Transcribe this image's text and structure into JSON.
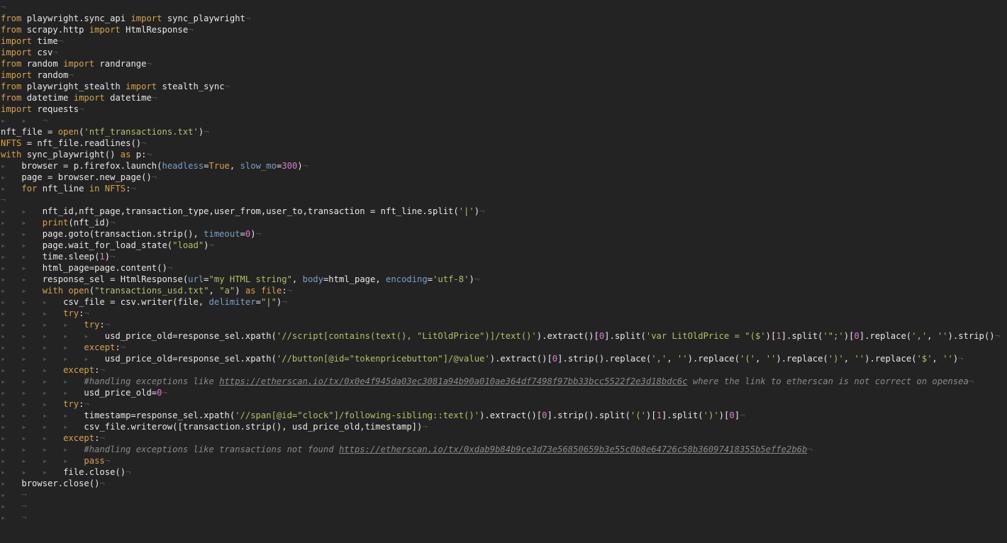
{
  "editor": {
    "theme": {
      "background": "#232323",
      "text": "#e8e8e8",
      "keyword": "#d9a24a",
      "string": "#b7bf6a",
      "number": "#d37fd0",
      "parameter": "#7a9fc7",
      "comment": "#8a8a8a",
      "invisible": "#4e4e4e"
    },
    "lines": [
      [],
      [
        [
          "kw",
          "from"
        ],
        [
          "t",
          " playwright.sync_api "
        ],
        [
          "kw",
          "import"
        ],
        [
          "t",
          " sync_playwright"
        ]
      ],
      [
        [
          "kw",
          "from"
        ],
        [
          "t",
          " scrapy.http "
        ],
        [
          "kw",
          "import"
        ],
        [
          "t",
          " HtmlResponse"
        ]
      ],
      [
        [
          "kw",
          "import"
        ],
        [
          "t",
          " time"
        ]
      ],
      [
        [
          "kw",
          "import"
        ],
        [
          "t",
          " csv"
        ]
      ],
      [
        [
          "kw",
          "from"
        ],
        [
          "t",
          " random "
        ],
        [
          "kw",
          "import"
        ],
        [
          "t",
          " randrange"
        ]
      ],
      [
        [
          "kw",
          "import"
        ],
        [
          "t",
          " random"
        ]
      ],
      [
        [
          "kw",
          "from"
        ],
        [
          "t",
          " playwright_stealth "
        ],
        [
          "kw",
          "import"
        ],
        [
          "t",
          " stealth_sync"
        ]
      ],
      [
        [
          "kw",
          "from"
        ],
        [
          "t",
          " datetime "
        ],
        [
          "kw",
          "import"
        ],
        [
          "t",
          " datetime"
        ]
      ],
      [
        [
          "kw",
          "import"
        ],
        [
          "t",
          " requests"
        ]
      ],
      [
        [
          "inv",
          "▸   ▸   "
        ]
      ],
      [
        [
          "t",
          "nft_file = "
        ],
        [
          "kw",
          "open"
        ],
        [
          "t",
          "("
        ],
        [
          "str",
          "'ntf_transactions.txt'"
        ],
        [
          "t",
          ")"
        ]
      ],
      [
        [
          "vr",
          "NFTS"
        ],
        [
          "t",
          " = nft_file.readlines()"
        ]
      ],
      [
        [
          "kw",
          "with"
        ],
        [
          "t",
          " sync_playwright() "
        ],
        [
          "kw",
          "as"
        ],
        [
          "t",
          " p:"
        ]
      ],
      [
        [
          "inv",
          "▸   "
        ],
        [
          "t",
          "browser = p.firefox.launch("
        ],
        [
          "par",
          "headless"
        ],
        [
          "t",
          "="
        ],
        [
          "kw",
          "True"
        ],
        [
          "t",
          ", "
        ],
        [
          "par",
          "slow_mo"
        ],
        [
          "t",
          "="
        ],
        [
          "num",
          "300"
        ],
        [
          "t",
          ")"
        ]
      ],
      [
        [
          "inv",
          "▸   "
        ],
        [
          "t",
          "page = browser.new_page()"
        ]
      ],
      [
        [
          "inv",
          "▸   "
        ],
        [
          "kw",
          "for"
        ],
        [
          "t",
          " nft_line "
        ],
        [
          "kw",
          "in"
        ],
        [
          "t",
          " "
        ],
        [
          "vr",
          "NFTS"
        ],
        [
          "t",
          ":"
        ]
      ],
      [],
      [
        [
          "inv",
          "▸   ▸   "
        ],
        [
          "t",
          "nft_id,nft_page,transaction_type,user_from,user_to,transaction = nft_line.split("
        ],
        [
          "str",
          "'|'"
        ],
        [
          "t",
          ")"
        ]
      ],
      [
        [
          "inv",
          "▸   ▸   "
        ],
        [
          "kw",
          "print"
        ],
        [
          "t",
          "(nft_id)"
        ]
      ],
      [
        [
          "inv",
          "▸   ▸   "
        ],
        [
          "t",
          "page.goto(transaction.strip(), "
        ],
        [
          "par",
          "timeout"
        ],
        [
          "t",
          "="
        ],
        [
          "num",
          "0"
        ],
        [
          "t",
          ")"
        ]
      ],
      [
        [
          "inv",
          "▸   ▸   "
        ],
        [
          "t",
          "page.wait_for_load_state("
        ],
        [
          "str",
          "\"load\""
        ],
        [
          "t",
          ")"
        ]
      ],
      [
        [
          "inv",
          "▸   ▸   "
        ],
        [
          "t",
          "time.sleep("
        ],
        [
          "num",
          "1"
        ],
        [
          "t",
          ")"
        ]
      ],
      [
        [
          "inv",
          "▸   ▸   "
        ],
        [
          "t",
          "html_page=page.content()"
        ]
      ],
      [
        [
          "inv",
          "▸   ▸   "
        ],
        [
          "t",
          "response_sel = HtmlResponse("
        ],
        [
          "par",
          "url"
        ],
        [
          "t",
          "="
        ],
        [
          "str",
          "\"my HTML string\""
        ],
        [
          "t",
          ", "
        ],
        [
          "par",
          "body"
        ],
        [
          "t",
          "=html_page, "
        ],
        [
          "par",
          "encoding"
        ],
        [
          "t",
          "="
        ],
        [
          "str",
          "'utf-8'"
        ],
        [
          "t",
          ")"
        ]
      ],
      [
        [
          "inv",
          "▸   ▸   "
        ],
        [
          "kw",
          "with"
        ],
        [
          "t",
          " "
        ],
        [
          "kw",
          "open"
        ],
        [
          "t",
          "("
        ],
        [
          "str",
          "\"transactions_usd.txt\""
        ],
        [
          "t",
          ", "
        ],
        [
          "str",
          "\"a\""
        ],
        [
          "t",
          ") "
        ],
        [
          "kw",
          "as"
        ],
        [
          "t",
          " "
        ],
        [
          "kw",
          "file"
        ],
        [
          "t",
          ":"
        ]
      ],
      [
        [
          "inv",
          "▸   ▸   ▸   "
        ],
        [
          "t",
          "csv_file = csv.writer(file, "
        ],
        [
          "par",
          "delimiter"
        ],
        [
          "t",
          "="
        ],
        [
          "str",
          "\"|\""
        ],
        [
          "t",
          ")"
        ]
      ],
      [
        [
          "inv",
          "▸   ▸   ▸   "
        ],
        [
          "kw",
          "try"
        ],
        [
          "t",
          ":"
        ]
      ],
      [
        [
          "inv",
          "▸   ▸   ▸   ▸   "
        ],
        [
          "kw",
          "try"
        ],
        [
          "t",
          ":"
        ]
      ],
      [
        [
          "inv",
          "▸   ▸   ▸   ▸   ▸   "
        ],
        [
          "t",
          "usd_price_old=response_sel.xpath("
        ],
        [
          "str",
          "'//script[contains(text(), \"LitOldPrice\")]/text()'"
        ],
        [
          "t",
          ").extract()["
        ],
        [
          "num",
          "0"
        ],
        [
          "t",
          "].split("
        ],
        [
          "str",
          "'var LitOldPrice = \"($'"
        ],
        [
          "t",
          ")["
        ],
        [
          "num",
          "1"
        ],
        [
          "t",
          "].split("
        ],
        [
          "str",
          "'\";'"
        ],
        [
          "t",
          ")["
        ],
        [
          "num",
          "0"
        ],
        [
          "t",
          "].replace("
        ],
        [
          "str",
          "','"
        ],
        [
          "t",
          ", "
        ],
        [
          "str",
          "''"
        ],
        [
          "t",
          ").strip()"
        ]
      ],
      [
        [
          "inv",
          "▸   ▸   ▸   ▸   "
        ],
        [
          "kw",
          "except"
        ],
        [
          "t",
          ":"
        ]
      ],
      [
        [
          "inv",
          "▸   ▸   ▸   ▸   ▸   "
        ],
        [
          "t",
          "usd_price_old=response_sel.xpath("
        ],
        [
          "str",
          "'//button[@id=\"tokenpricebutton\"]/@value'"
        ],
        [
          "t",
          ").extract()["
        ],
        [
          "num",
          "0"
        ],
        [
          "t",
          "].strip().replace("
        ],
        [
          "str",
          "','"
        ],
        [
          "t",
          ", "
        ],
        [
          "str",
          "''"
        ],
        [
          "t",
          ").replace("
        ],
        [
          "str",
          "'('"
        ],
        [
          "t",
          ", "
        ],
        [
          "str",
          "''"
        ],
        [
          "t",
          ").replace("
        ],
        [
          "str",
          "')'"
        ],
        [
          "t",
          ", "
        ],
        [
          "str",
          "''"
        ],
        [
          "t",
          ").replace("
        ],
        [
          "str",
          "'$'"
        ],
        [
          "t",
          ", "
        ],
        [
          "str",
          "''"
        ],
        [
          "t",
          ")"
        ]
      ],
      [
        [
          "inv",
          "▸   ▸   ▸   "
        ],
        [
          "kw",
          "except"
        ],
        [
          "t",
          ":"
        ]
      ],
      [
        [
          "inv",
          "▸   ▸   ▸   ▸   "
        ],
        [
          "cm",
          "#handling exceptions like "
        ],
        [
          "lnk",
          "https://etherscan.io/tx/0x0e4f945da03ec3081a94b90a010ae364df7498f97bb33bcc5522f2e3d18bdc6c"
        ],
        [
          "cm",
          " where the link to etherscan is not correct on opensea"
        ]
      ],
      [
        [
          "inv",
          "▸   ▸   ▸   ▸   "
        ],
        [
          "t",
          "usd_price_old="
        ],
        [
          "num",
          "0"
        ]
      ],
      [
        [
          "inv",
          "▸   ▸   ▸   "
        ],
        [
          "kw",
          "try"
        ],
        [
          "t",
          ":"
        ]
      ],
      [
        [
          "inv",
          "▸   ▸   ▸   ▸   "
        ],
        [
          "t",
          "timestamp=response_sel.xpath("
        ],
        [
          "str",
          "'//span[@id=\"clock\"]/following-sibling::text()'"
        ],
        [
          "t",
          ").extract()["
        ],
        [
          "num",
          "0"
        ],
        [
          "t",
          "].strip().split("
        ],
        [
          "str",
          "'('"
        ],
        [
          "t",
          ")["
        ],
        [
          "num",
          "1"
        ],
        [
          "t",
          "].split("
        ],
        [
          "str",
          "')'"
        ],
        [
          "t",
          ")["
        ],
        [
          "num",
          "0"
        ],
        [
          "t",
          "]"
        ]
      ],
      [
        [
          "inv",
          "▸   ▸   ▸   ▸   "
        ],
        [
          "t",
          "csv_file.writerow([transaction.strip(), usd_price_old,timestamp])"
        ]
      ],
      [
        [
          "inv",
          "▸   ▸   ▸   "
        ],
        [
          "kw",
          "except"
        ],
        [
          "t",
          ":"
        ]
      ],
      [
        [
          "inv",
          "▸   ▸   ▸   ▸   "
        ],
        [
          "cm",
          "#handling exceptions like transactions not found "
        ],
        [
          "lnk",
          "https://etherscan.io/tx/0xdab9b84b9ce3d73e56850659b3e55c0b8e64726c58b36097418355b5effe2b6b"
        ]
      ],
      [
        [
          "inv",
          "▸   ▸   ▸   ▸   "
        ],
        [
          "kw",
          "pass"
        ]
      ],
      [
        [
          "inv",
          "▸   ▸   ▸   "
        ],
        [
          "t",
          "file.close()"
        ]
      ],
      [
        [
          "inv",
          "▸   "
        ],
        [
          "t",
          "browser.close()"
        ]
      ],
      [
        [
          "inv",
          "▸   "
        ]
      ],
      [
        [
          "inv",
          "▸   "
        ]
      ],
      [
        [
          "inv",
          "▸   "
        ]
      ]
    ]
  }
}
